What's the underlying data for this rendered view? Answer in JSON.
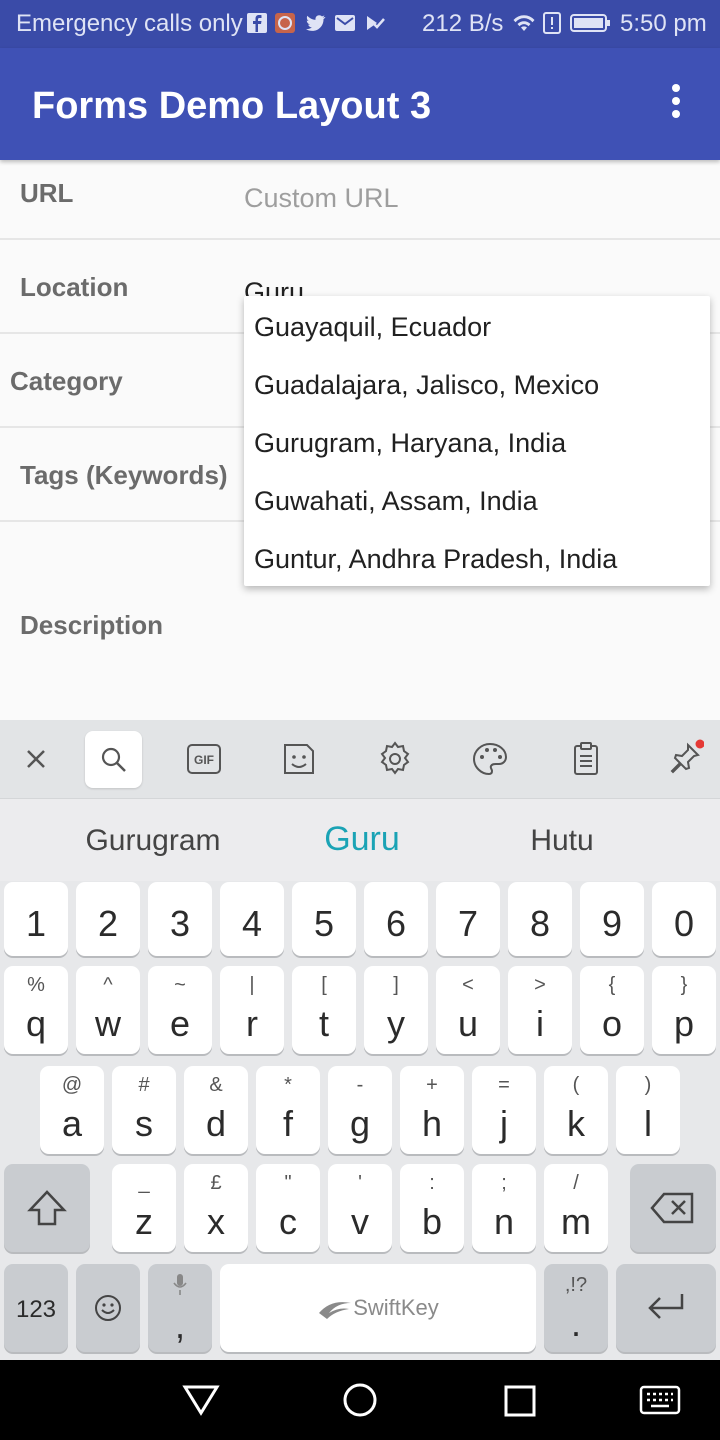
{
  "status_bar": {
    "carrier": "Emergency calls only",
    "network_speed": "212 B/s",
    "time": "5:50 pm",
    "notification_icons": [
      "facebook-icon",
      "app-icon",
      "twitter-icon",
      "mail-icon",
      "check-icon"
    ],
    "system_icons": [
      "wifi-icon",
      "alert-icon",
      "battery-icon"
    ]
  },
  "app_bar": {
    "title": "Forms Demo Layout 3",
    "menu_icon": "overflow-menu-icon",
    "color": "#3f51b5"
  },
  "form": {
    "url": {
      "label": "URL",
      "placeholder": "Custom URL"
    },
    "location": {
      "label": "Location",
      "value": "Guru"
    },
    "category": {
      "label": "Category"
    },
    "tags": {
      "label": "Tags (Keywords)"
    },
    "description": {
      "label": "Description"
    }
  },
  "dropdown": {
    "items": [
      "Guayaquil, Ecuador",
      "Guadalajara, Jalisco, Mexico",
      "Gurugram, Haryana, India",
      "Guwahati, Assam, India",
      "Guntur, Andhra Pradesh, India"
    ]
  },
  "keyboard": {
    "toolbar_icons": [
      "close-icon",
      "search-icon",
      "gif-icon",
      "sticker-icon",
      "settings-icon",
      "theme-icon",
      "clipboard-icon",
      "pin-icon"
    ],
    "suggestions": [
      "Gurugram",
      "Guru",
      "Hutu"
    ],
    "accent_color": "#1aa3b5",
    "number_row": [
      "1",
      "2",
      "3",
      "4",
      "5",
      "6",
      "7",
      "8",
      "9",
      "0"
    ],
    "row1": [
      {
        "k": "q",
        "s": "%"
      },
      {
        "k": "w",
        "s": "^"
      },
      {
        "k": "e",
        "s": "~"
      },
      {
        "k": "r",
        "s": "|"
      },
      {
        "k": "t",
        "s": "["
      },
      {
        "k": "y",
        "s": "]"
      },
      {
        "k": "u",
        "s": "<"
      },
      {
        "k": "i",
        "s": ">"
      },
      {
        "k": "o",
        "s": "{"
      },
      {
        "k": "p",
        "s": "}"
      }
    ],
    "row2": [
      {
        "k": "a",
        "s": "@"
      },
      {
        "k": "s",
        "s": "#"
      },
      {
        "k": "d",
        "s": "&"
      },
      {
        "k": "f",
        "s": "*"
      },
      {
        "k": "g",
        "s": "-"
      },
      {
        "k": "h",
        "s": "+"
      },
      {
        "k": "j",
        "s": "="
      },
      {
        "k": "k",
        "s": "("
      },
      {
        "k": "l",
        "s": ")"
      }
    ],
    "row3": [
      {
        "k": "z",
        "s": "_"
      },
      {
        "k": "x",
        "s": "£"
      },
      {
        "k": "c",
        "s": "\""
      },
      {
        "k": "v",
        "s": "'"
      },
      {
        "k": "b",
        "s": ":"
      },
      {
        "k": "n",
        "s": ";"
      },
      {
        "k": "m",
        "s": "/"
      }
    ],
    "num_key": "123",
    "comma": ",",
    "period": ".",
    "period_secondary": ",!?",
    "space_brand": "SwiftKey"
  },
  "nav_bar": {
    "icons": [
      "back-icon",
      "home-icon",
      "recents-icon",
      "keyboard-icon"
    ]
  }
}
